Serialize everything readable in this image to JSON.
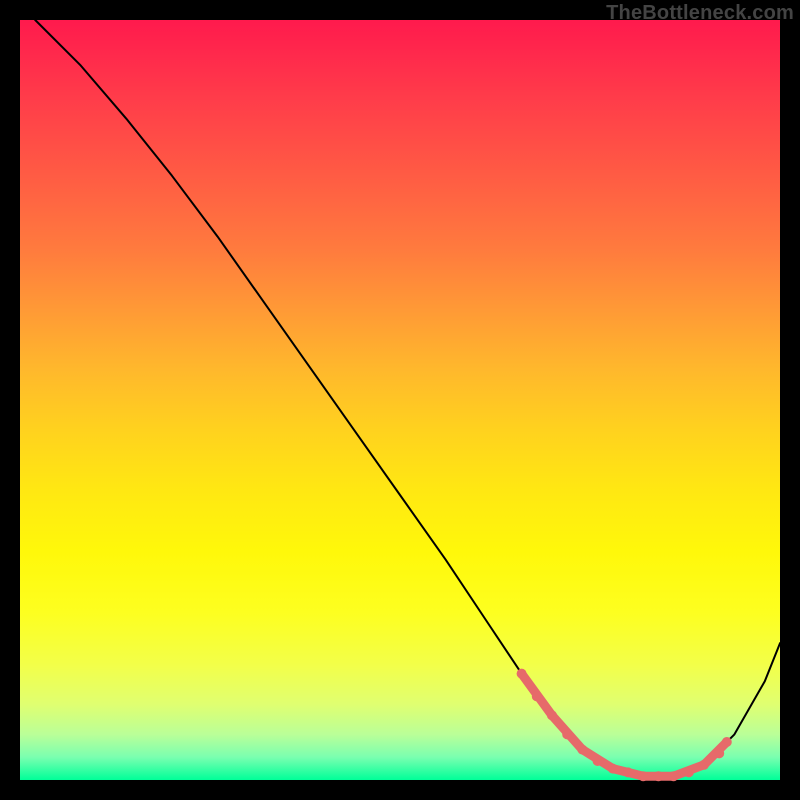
{
  "watermark": "TheBottleneck.com",
  "chart_data": {
    "type": "line",
    "title": "",
    "xlabel": "",
    "ylabel": "",
    "xlim": [
      0,
      100
    ],
    "ylim": [
      0,
      100
    ],
    "grid": false,
    "series": [
      {
        "name": "curve",
        "x": [
          2,
          8,
          14,
          20,
          26,
          32,
          38,
          44,
          50,
          56,
          62,
          66,
          70,
          74,
          78,
          82,
          86,
          90,
          94,
          98,
          100
        ],
        "y": [
          100,
          94,
          87,
          79.5,
          71.5,
          63,
          54.5,
          46,
          37.5,
          29,
          20,
          14,
          8.5,
          4,
          1.5,
          0.5,
          0.5,
          2,
          6,
          13,
          18
        ]
      },
      {
        "name": "accent-left",
        "x": [
          66,
          70,
          74
        ],
        "y": [
          14,
          8.5,
          4
        ]
      },
      {
        "name": "accent-flat",
        "x": [
          74,
          78,
          82,
          86
        ],
        "y": [
          4,
          1.5,
          0.5,
          0.5
        ]
      },
      {
        "name": "accent-right",
        "x": [
          86,
          90,
          93
        ],
        "y": [
          0.5,
          2,
          5
        ]
      }
    ],
    "dots": {
      "x": [
        66,
        68,
        70,
        72,
        74,
        76,
        78,
        80,
        82,
        84,
        86,
        88,
        90,
        92,
        93
      ],
      "y": [
        14,
        11,
        8.5,
        6,
        4,
        2.5,
        1.5,
        1,
        0.5,
        0.5,
        0.5,
        1,
        2,
        3.5,
        5
      ]
    }
  }
}
